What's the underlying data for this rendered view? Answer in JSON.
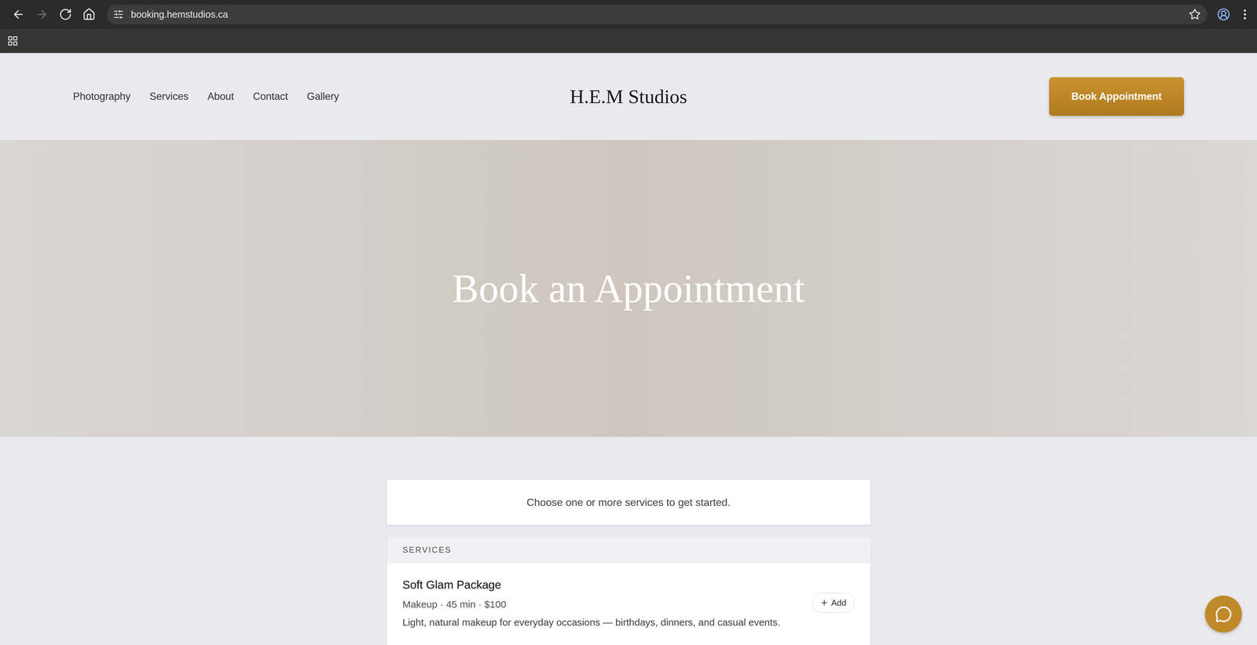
{
  "browser": {
    "url": "booking.hemstudios.ca",
    "nav_buttons": [
      {
        "name": "back",
        "disabled": false
      },
      {
        "name": "forward",
        "disabled": true
      },
      {
        "name": "reload",
        "disabled": false
      },
      {
        "name": "home",
        "disabled": false
      }
    ]
  },
  "header": {
    "nav": [
      "Photography",
      "Services",
      "About",
      "Contact",
      "Gallery"
    ],
    "logo": "H.E.M Studios",
    "cta": "Book Appointment"
  },
  "hero": {
    "title": "Book an Appointment"
  },
  "prompt": "Choose one or more services to get started.",
  "services": {
    "heading": "SERVICES",
    "items": [
      {
        "name": "Soft Glam Package",
        "meta": "Makeup · 45 min · $100",
        "description": "Light, natural makeup for everyday occasions — birthdays, dinners, and casual events.",
        "action": "Add"
      }
    ]
  }
}
